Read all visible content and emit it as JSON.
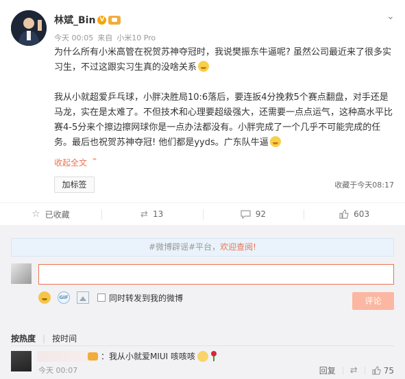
{
  "post": {
    "username": "林斌_Bin",
    "verified_mark": "V",
    "time": "今天 00:05",
    "source_prefix": "来自",
    "source": "小米10 Pro",
    "paragraphs": [
      "为什么所有小米高管在祝贺苏神夺冠时，我说樊振东牛逼呢? 虽然公司最近来了很多实习生，不过这跟实习生真的没啥关系",
      "我从小就超爱乒乓球，小胖决胜局10:6落后，要连扳4分挽救5个赛点翻盘，对手还是马龙，实在是太难了。不但技术和心理要超级强大，还需要一点点运气，这种高水平比赛4-5分来个擦边擦网球你是一点办法都没有。小胖完成了一个几乎不可能完成的任务。最后也祝贺苏神夺冠! 他们都是yyds。广东队牛逼"
    ],
    "collapse_label": "收起全文",
    "collapse_icon": "^",
    "tag_button": "加标签",
    "favorite_time": "收藏于今天08:17",
    "icons": {
      "avatar": "user-avatar",
      "more": "chevron-down-icon",
      "vip": "vip-badge-icon"
    }
  },
  "actions": [
    {
      "icon": "star-icon",
      "glyph": "☆",
      "label": "已收藏"
    },
    {
      "icon": "repost-icon",
      "glyph": "⇄",
      "label": "13"
    },
    {
      "icon": "comment-icon",
      "glyph": "▭",
      "label": "92"
    },
    {
      "icon": "like-icon",
      "glyph": "👍",
      "label": "603"
    }
  ],
  "comment_box": {
    "notice_hash1": "#微博辟谣#",
    "notice_hash2": "平台，",
    "notice_link": "欢迎查阅!",
    "input_value": "",
    "repost_label": "同时转发到我的微博",
    "submit_label": "评论"
  },
  "sort": {
    "hot": "按热度",
    "time": "按时间"
  },
  "comment": {
    "text": "：我从小就爱MIUI 咳咳咳",
    "time": "今天 00:07",
    "reply_label": "回复",
    "like_count": "75"
  },
  "colors": {
    "accent": "#eb7350",
    "background": "#f2f2f5",
    "submit_disabled": "#fbb7a2"
  }
}
